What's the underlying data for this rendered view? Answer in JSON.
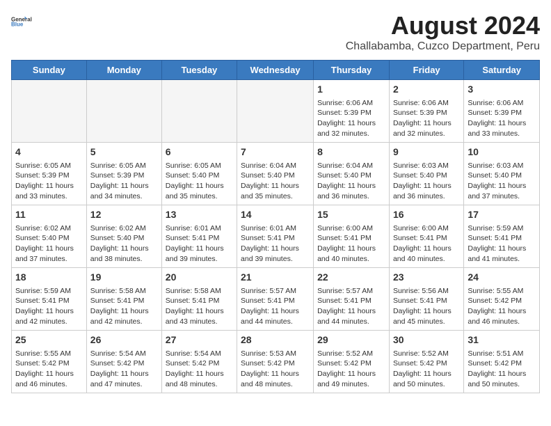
{
  "header": {
    "logo_general": "General",
    "logo_blue": "Blue",
    "title": "August 2024",
    "subtitle": "Challabamba, Cuzco Department, Peru"
  },
  "days_of_week": [
    "Sunday",
    "Monday",
    "Tuesday",
    "Wednesday",
    "Thursday",
    "Friday",
    "Saturday"
  ],
  "weeks": [
    [
      {
        "day": "",
        "empty": true
      },
      {
        "day": "",
        "empty": true
      },
      {
        "day": "",
        "empty": true
      },
      {
        "day": "",
        "empty": true
      },
      {
        "day": "1",
        "sunrise": "6:06 AM",
        "sunset": "5:39 PM",
        "daylight": "11 hours and 32 minutes."
      },
      {
        "day": "2",
        "sunrise": "6:06 AM",
        "sunset": "5:39 PM",
        "daylight": "11 hours and 32 minutes."
      },
      {
        "day": "3",
        "sunrise": "6:06 AM",
        "sunset": "5:39 PM",
        "daylight": "11 hours and 33 minutes."
      }
    ],
    [
      {
        "day": "4",
        "sunrise": "6:05 AM",
        "sunset": "5:39 PM",
        "daylight": "11 hours and 33 minutes."
      },
      {
        "day": "5",
        "sunrise": "6:05 AM",
        "sunset": "5:39 PM",
        "daylight": "11 hours and 34 minutes."
      },
      {
        "day": "6",
        "sunrise": "6:05 AM",
        "sunset": "5:40 PM",
        "daylight": "11 hours and 35 minutes."
      },
      {
        "day": "7",
        "sunrise": "6:04 AM",
        "sunset": "5:40 PM",
        "daylight": "11 hours and 35 minutes."
      },
      {
        "day": "8",
        "sunrise": "6:04 AM",
        "sunset": "5:40 PM",
        "daylight": "11 hours and 36 minutes."
      },
      {
        "day": "9",
        "sunrise": "6:03 AM",
        "sunset": "5:40 PM",
        "daylight": "11 hours and 36 minutes."
      },
      {
        "day": "10",
        "sunrise": "6:03 AM",
        "sunset": "5:40 PM",
        "daylight": "11 hours and 37 minutes."
      }
    ],
    [
      {
        "day": "11",
        "sunrise": "6:02 AM",
        "sunset": "5:40 PM",
        "daylight": "11 hours and 37 minutes."
      },
      {
        "day": "12",
        "sunrise": "6:02 AM",
        "sunset": "5:40 PM",
        "daylight": "11 hours and 38 minutes."
      },
      {
        "day": "13",
        "sunrise": "6:01 AM",
        "sunset": "5:41 PM",
        "daylight": "11 hours and 39 minutes."
      },
      {
        "day": "14",
        "sunrise": "6:01 AM",
        "sunset": "5:41 PM",
        "daylight": "11 hours and 39 minutes."
      },
      {
        "day": "15",
        "sunrise": "6:00 AM",
        "sunset": "5:41 PM",
        "daylight": "11 hours and 40 minutes."
      },
      {
        "day": "16",
        "sunrise": "6:00 AM",
        "sunset": "5:41 PM",
        "daylight": "11 hours and 40 minutes."
      },
      {
        "day": "17",
        "sunrise": "5:59 AM",
        "sunset": "5:41 PM",
        "daylight": "11 hours and 41 minutes."
      }
    ],
    [
      {
        "day": "18",
        "sunrise": "5:59 AM",
        "sunset": "5:41 PM",
        "daylight": "11 hours and 42 minutes."
      },
      {
        "day": "19",
        "sunrise": "5:58 AM",
        "sunset": "5:41 PM",
        "daylight": "11 hours and 42 minutes."
      },
      {
        "day": "20",
        "sunrise": "5:58 AM",
        "sunset": "5:41 PM",
        "daylight": "11 hours and 43 minutes."
      },
      {
        "day": "21",
        "sunrise": "5:57 AM",
        "sunset": "5:41 PM",
        "daylight": "11 hours and 44 minutes."
      },
      {
        "day": "22",
        "sunrise": "5:57 AM",
        "sunset": "5:41 PM",
        "daylight": "11 hours and 44 minutes."
      },
      {
        "day": "23",
        "sunrise": "5:56 AM",
        "sunset": "5:41 PM",
        "daylight": "11 hours and 45 minutes."
      },
      {
        "day": "24",
        "sunrise": "5:55 AM",
        "sunset": "5:42 PM",
        "daylight": "11 hours and 46 minutes."
      }
    ],
    [
      {
        "day": "25",
        "sunrise": "5:55 AM",
        "sunset": "5:42 PM",
        "daylight": "11 hours and 46 minutes."
      },
      {
        "day": "26",
        "sunrise": "5:54 AM",
        "sunset": "5:42 PM",
        "daylight": "11 hours and 47 minutes."
      },
      {
        "day": "27",
        "sunrise": "5:54 AM",
        "sunset": "5:42 PM",
        "daylight": "11 hours and 48 minutes."
      },
      {
        "day": "28",
        "sunrise": "5:53 AM",
        "sunset": "5:42 PM",
        "daylight": "11 hours and 48 minutes."
      },
      {
        "day": "29",
        "sunrise": "5:52 AM",
        "sunset": "5:42 PM",
        "daylight": "11 hours and 49 minutes."
      },
      {
        "day": "30",
        "sunrise": "5:52 AM",
        "sunset": "5:42 PM",
        "daylight": "11 hours and 50 minutes."
      },
      {
        "day": "31",
        "sunrise": "5:51 AM",
        "sunset": "5:42 PM",
        "daylight": "11 hours and 50 minutes."
      }
    ]
  ],
  "labels": {
    "sunrise_prefix": "Sunrise: ",
    "sunset_prefix": "Sunset: ",
    "daylight_prefix": "Daylight: "
  }
}
